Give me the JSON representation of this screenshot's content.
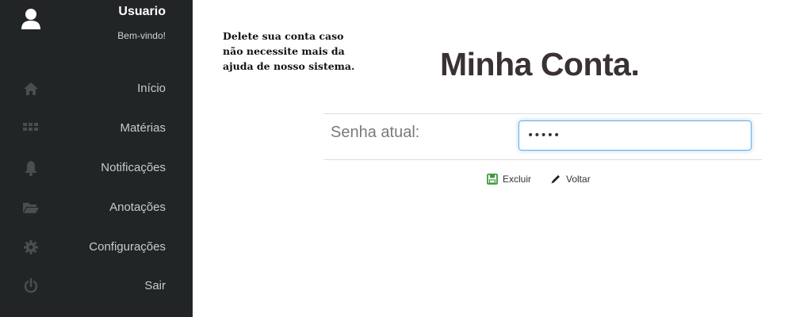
{
  "user": {
    "name": "Usuario",
    "welcome": "Bem-vindo!"
  },
  "sidebar": {
    "items": [
      {
        "label": "Início",
        "icon": "home-icon"
      },
      {
        "label": "Matérias",
        "icon": "grid-icon"
      },
      {
        "label": "Notificações",
        "icon": "bell-icon"
      },
      {
        "label": "Anotações",
        "icon": "folder-open-icon"
      },
      {
        "label": "Configurações",
        "icon": "gear-icon"
      },
      {
        "label": "Sair",
        "icon": "power-icon"
      }
    ]
  },
  "main": {
    "notice": "Delete sua conta caso não necessite mais da ajuda de nosso sistema.",
    "title": "Minha Conta.",
    "form": {
      "password_label": "Senha atual:",
      "password_value": "•••••"
    },
    "actions": {
      "delete_label": "Excluir",
      "back_label": "Voltar"
    }
  },
  "colors": {
    "sidebar_bg": "#222526",
    "save_icon": "#3c9a3c",
    "input_focus": "#66afe9"
  }
}
